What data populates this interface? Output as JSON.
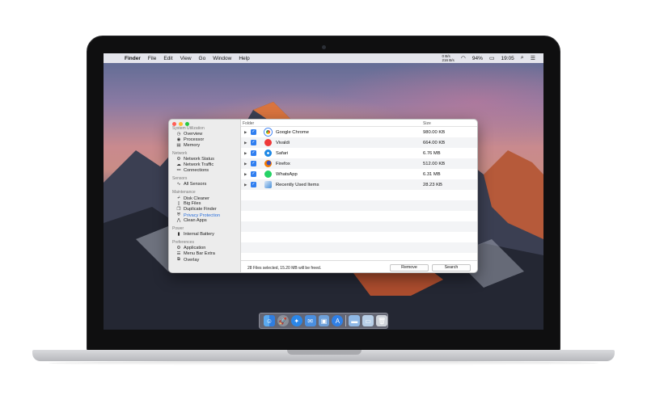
{
  "menubar": {
    "apple": "",
    "menus": [
      "Finder",
      "File",
      "Edit",
      "View",
      "Go",
      "Window",
      "Help"
    ],
    "net_up": "0 B/s",
    "net_down": "216 B/s",
    "battery": "94%",
    "time": "19:05"
  },
  "sidebar": {
    "sections": [
      {
        "title": "System Utilization",
        "items": [
          {
            "label": "Overview",
            "icon": "clock-icon"
          },
          {
            "label": "Processor",
            "icon": "cpu-icon"
          },
          {
            "label": "Memory",
            "icon": "memory-icon"
          }
        ]
      },
      {
        "title": "Network",
        "items": [
          {
            "label": "Network Status",
            "icon": "network-icon"
          },
          {
            "label": "Network Traffic",
            "icon": "cloud-icon"
          },
          {
            "label": "Connections",
            "icon": "connections-icon"
          }
        ]
      },
      {
        "title": "Sensors",
        "items": [
          {
            "label": "All Sensors",
            "icon": "pulse-icon"
          }
        ]
      },
      {
        "title": "Maintenance",
        "items": [
          {
            "label": "Disk Cleaner",
            "icon": "broom-icon"
          },
          {
            "label": "Big Files",
            "icon": "file-icon"
          },
          {
            "label": "Duplicate Finder",
            "icon": "duplicate-icon"
          },
          {
            "label": "Privacy Protection",
            "icon": "shield-icon"
          },
          {
            "label": "Clean Apps",
            "icon": "apps-icon"
          }
        ]
      },
      {
        "title": "Power",
        "items": [
          {
            "label": "Internal Battery",
            "icon": "battery-icon"
          }
        ]
      },
      {
        "title": "Preferences",
        "items": [
          {
            "label": "Application",
            "icon": "gear-icon"
          },
          {
            "label": "Menu Bar Extra",
            "icon": "menubar-icon"
          },
          {
            "label": "Overlay",
            "icon": "overlay-icon"
          }
        ]
      }
    ],
    "active": "Privacy Protection"
  },
  "table": {
    "col_folder": "Folder",
    "col_size": "Size",
    "rows": [
      {
        "name": "Google Chrome",
        "size": "980.00 KB",
        "icon_color": "#e8453c"
      },
      {
        "name": "Vivaldi",
        "size": "664.00 KB",
        "icon_color": "#ef3939"
      },
      {
        "name": "Safari",
        "size": "6.76 MB",
        "icon_color": "#1e88e5"
      },
      {
        "name": "Firefox",
        "size": "512.00 KB",
        "icon_color": "#f57c00"
      },
      {
        "name": "WhatsApp",
        "size": "6.31 MB",
        "icon_color": "#25d366"
      },
      {
        "name": "Recently Used Items",
        "size": "28.23 KB",
        "icon_color": "#4a90d9"
      }
    ]
  },
  "footer": {
    "status": "28 Files selected, 15.20 MB will be freed.",
    "remove_label": "Remove",
    "search_label": "Search"
  },
  "dock": {
    "icons": [
      "finder-icon",
      "launchpad-icon",
      "safari-icon",
      "mail-icon",
      "preview-icon",
      "appstore-icon",
      "downloads-icon",
      "documents-icon",
      "trash-icon"
    ]
  }
}
